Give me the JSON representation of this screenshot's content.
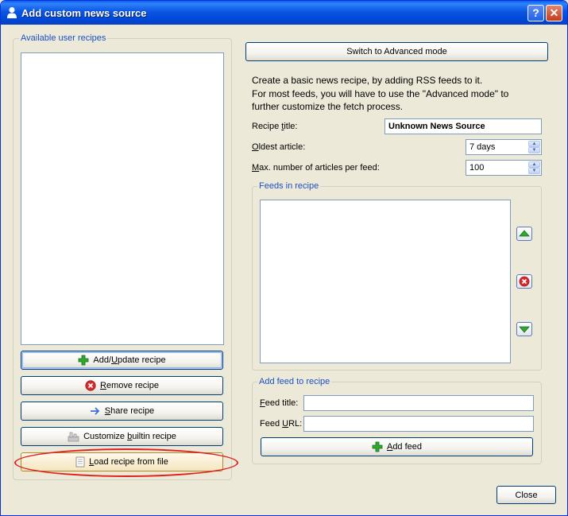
{
  "window": {
    "title": "Add custom news source",
    "help_label": "?",
    "close_label": "✕"
  },
  "left": {
    "group_title": "Available user recipes",
    "buttons": {
      "add_update": {
        "prefix": "Add/",
        "ul": "U",
        "suffix": "pdate recipe"
      },
      "remove": {
        "prefix": "",
        "ul": "R",
        "suffix": "emove recipe"
      },
      "share": {
        "prefix": "",
        "ul": "S",
        "suffix": "hare recipe"
      },
      "customize": {
        "prefix": "Customize ",
        "ul": "b",
        "suffix": "uiltin recipe"
      },
      "load": {
        "prefix": "",
        "ul": "L",
        "suffix": "oad recipe from file"
      }
    }
  },
  "right": {
    "advanced_button": "Switch to Advanced mode",
    "description_lines": [
      "Create a basic news recipe, by adding RSS feeds to it.",
      "For most feeds, you will have to use the \"Advanced mode\" to",
      "further customize the fetch process."
    ],
    "recipe_title": {
      "prefix": "Recipe ",
      "ul": "t",
      "suffix": "itle:",
      "value": "Unknown News Source"
    },
    "oldest_article": {
      "prefix": "",
      "ul": "O",
      "suffix": "ldest article:",
      "value": "7 days"
    },
    "max_articles": {
      "prefix": "",
      "ul": "M",
      "suffix": "ax. number of articles per feed:",
      "value": "100"
    },
    "feeds_group_title": "Feeds in recipe",
    "add_feed_group_title": "Add feed to recipe",
    "feed_title": {
      "prefix": "",
      "ul": "F",
      "suffix": "eed title:",
      "value": ""
    },
    "feed_url": {
      "prefix": "Feed ",
      "ul": "U",
      "suffix": "RL:",
      "value": ""
    },
    "add_feed_button": {
      "prefix": "",
      "ul": "A",
      "suffix": "dd feed"
    }
  },
  "footer": {
    "close_button": "Close"
  },
  "colors": {
    "titlebar": "#0a56e3",
    "group_title": "#1a50c4",
    "highlight": "#e0201e"
  }
}
